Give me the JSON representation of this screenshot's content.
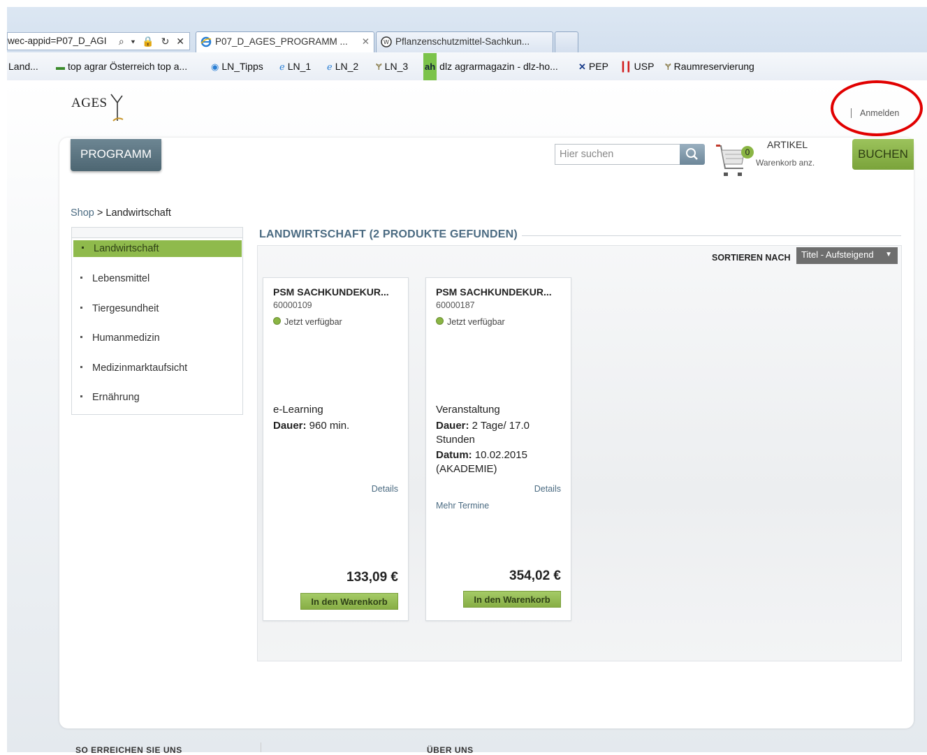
{
  "browser": {
    "address_url": "wec-appid=P07_D_AGI",
    "address_controls": "⌕ ▾ 🔒 ↻ ✕",
    "tabs": [
      {
        "label": "P07_D_AGES_PROGRAMM ...",
        "close": "✕"
      },
      {
        "label": "Pflanzenschutzmittel-Sachkun..."
      },
      {
        "label": ""
      }
    ],
    "favorites": [
      {
        "label": "Land...",
        "icon": "generic-icon"
      },
      {
        "label": "top agrar Österreich top a...",
        "icon": "topagrar-icon"
      },
      {
        "label": "LN_Tipps",
        "icon": "globe-icon"
      },
      {
        "label": "LN_1",
        "icon": "ie-icon"
      },
      {
        "label": "LN_2",
        "icon": "ie-icon"
      },
      {
        "label": "LN_3",
        "icon": "ages-icon"
      },
      {
        "label": "dlz agrarmagazin - dlz-ho...",
        "icon": "ah-icon",
        "prefix": "ah"
      },
      {
        "label": "PEP",
        "icon": "pep-icon"
      },
      {
        "label": "USP",
        "icon": "usp-icon"
      },
      {
        "label": "Raumreservierung",
        "icon": "ages-icon"
      }
    ]
  },
  "header": {
    "logo_text": "AGES",
    "login_label": "Anmelden"
  },
  "nav": {
    "programm_label": "PROGRAMM",
    "search_placeholder": "Hier suchen",
    "cart_count": "0",
    "cart_title": "ARTIKEL",
    "cart_view_label": "Warenkorb anz.",
    "buchen_label": "BUCHEN"
  },
  "breadcrumb": {
    "shop": "Shop",
    "separator": ">",
    "current": "Landwirtschaft"
  },
  "sidebar": {
    "items": [
      {
        "label": "Landwirtschaft",
        "active": true
      },
      {
        "label": "Lebensmittel"
      },
      {
        "label": "Tiergesundheit"
      },
      {
        "label": "Humanmedizin"
      },
      {
        "label": "Medizinmarktaufsicht"
      },
      {
        "label": "Ernährung"
      }
    ]
  },
  "results": {
    "title": "LANDWIRTSCHAFT (2 PRODUKTE GEFUNDEN)",
    "sort_label": "SORTIEREN NACH",
    "sort_value": "Titel - Aufsteigend"
  },
  "products": [
    {
      "name": "PSM SACHKUNDEKUR...",
      "number": "60000109",
      "availability": "Jetzt verfügbar",
      "type": "e-Learning",
      "duration_label": "Dauer:",
      "duration_value": " 960 min.",
      "details_label": "Details",
      "price": "133,09 €",
      "add_to_cart": "In den Warenkorb"
    },
    {
      "name": "PSM SACHKUNDEKUR...",
      "number": "60000187",
      "availability": "Jetzt verfügbar",
      "type": "Veranstaltung",
      "duration_label": "Dauer:",
      "duration_value": " 2 Tage/ 17.0 Stunden",
      "date_label": "Datum:",
      "date_value": " 10.02.2015 (AKADEMIE)",
      "details_label": "Details",
      "more_dates_label": "Mehr Termine",
      "price": "354,02 €",
      "add_to_cart": "In den Warenkorb"
    }
  ],
  "footer": {
    "col1": "SO ERREICHEN SIE UNS",
    "col2": "ÜBER UNS"
  },
  "colors": {
    "accent_green": "#8fba4c",
    "nav_slate": "#5a7380",
    "link_blue": "#4b6b82",
    "annotation_red": "#e10000"
  }
}
